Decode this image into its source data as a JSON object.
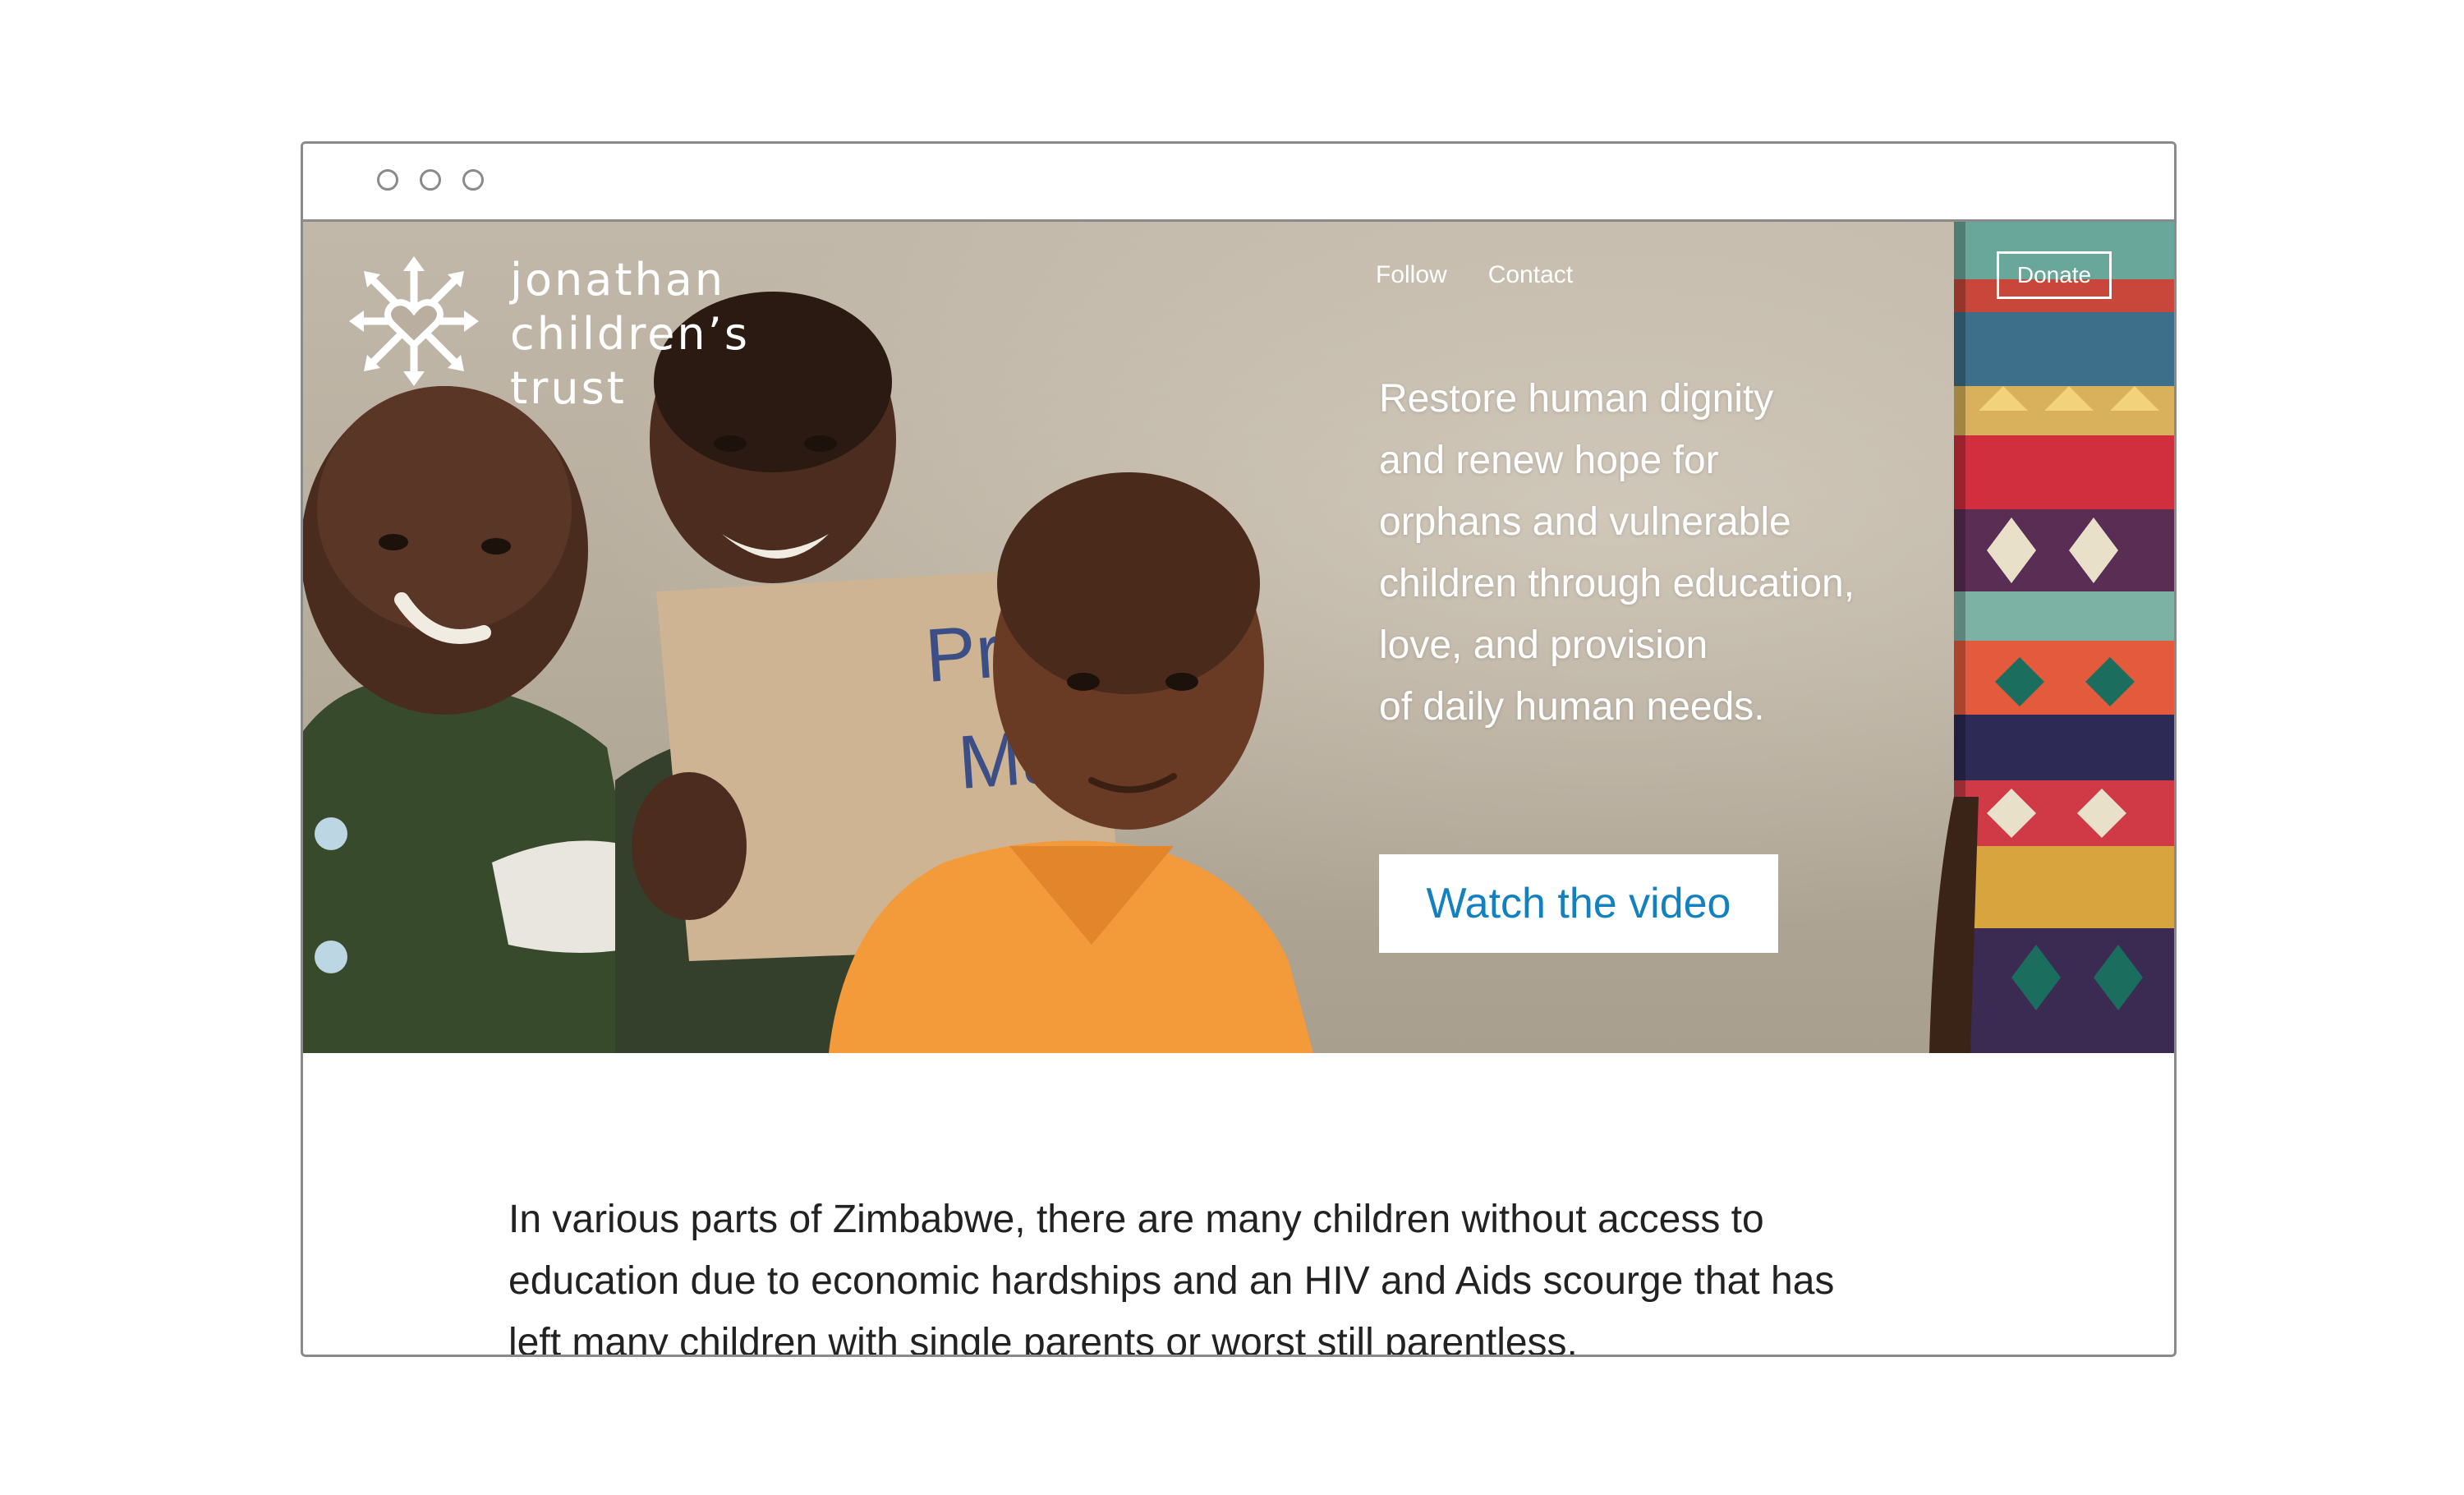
{
  "window": {
    "controls": [
      "window-dot-1",
      "window-dot-2",
      "window-dot-3"
    ]
  },
  "logo": {
    "lines": [
      "jonathan",
      "children’s",
      "trust"
    ],
    "icon": "heart-arrows-icon"
  },
  "nav": {
    "follow_label": "Follow",
    "contact_label": "Contact",
    "donate_label": "Donate"
  },
  "hero": {
    "headline_lines": [
      "Restore human dignity",
      "and renew hope for",
      "orphans and vulnerable",
      "children through education,",
      "love, and provision",
      "of daily human needs."
    ],
    "sign_text": [
      "Progres",
      "Ma"
    ],
    "cta_label": "Watch the video"
  },
  "intro": {
    "lines": [
      "In various parts of Zimbabwe, there are many children without access to",
      "education due to economic hardships and an HIV and Aids scourge that has",
      "left many children with single parents or worst still parentless."
    ]
  },
  "colors": {
    "accent": "#1380c0",
    "text_dark": "#222222",
    "frame": "#8a8a8a"
  }
}
